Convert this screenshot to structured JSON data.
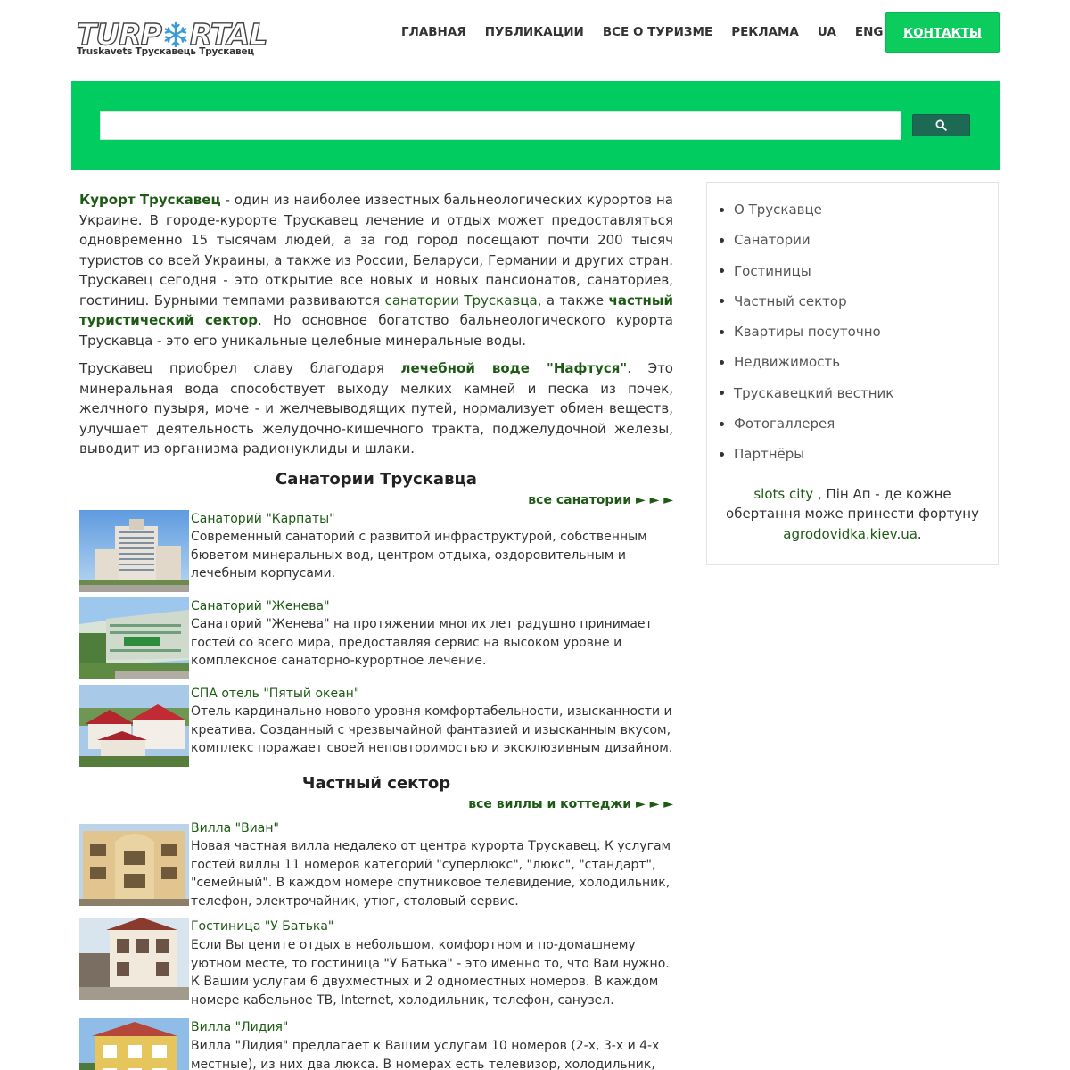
{
  "header": {
    "logo_text_left": "TURP",
    "logo_text_right": "RTAL",
    "logo_subtitle": "Truskavets Трускавець Трускавец",
    "nav": [
      "ГЛАВНАЯ",
      "ПУБЛИКАЦИИ",
      "ВСЕ О ТУРИЗМЕ",
      "РЕКЛАМА",
      "UA",
      "ENG"
    ],
    "contact_label": "КОНТАКТЫ"
  },
  "search": {
    "value": "",
    "button_icon": "search-icon"
  },
  "intro": {
    "p1_link1": "Курорт Трускавец",
    "p1_text1": " - один из наиболее известных бальнеологических курортов на Украине. В городе-курорте Трускавец лечение и отдых может предоставляться одновременно 15 тысячам людей, а за год город посещают почти 200 тысяч туристов со всей Украины, а также из России, Беларуси, Германии и других стран. Трускавец сегодня - это открытие все новых и новых пансионатов, санаториев, гостиниц. Бурными темпами развиваются ",
    "p1_link2": "санатории Трускавца",
    "p1_text2": ", а также ",
    "p1_link3": "частный туристический сектор",
    "p1_text3": ". Но основное богатство бальнеологического курорта Трускавца - это его уникальные целебные минеральные воды.",
    "p2_text1": "Трускавец приобрел славу благодаря ",
    "p2_link1": "лечебной воде \"Нафтуся\"",
    "p2_text2": ". Это минеральная вода способствует выходу мелких камней и песка из почек, желчного пузыря, моче - и желчевыводящих путей, нормализует обмен веществ, улучшает деятельность желудочно-кишечного тракта, поджелудочной железы, выводит из организма радионуклиды и шлаки."
  },
  "sanatoria": {
    "title": "Санатории Трускавца",
    "more": "все санатории ► ► ►",
    "items": [
      {
        "name": "Санаторий \"Карпаты\"",
        "desc": "Современный санаторий с развитой инфраструктурой, собственным бюветом минеральных вод, центром отдыха, оздоровительным и лечебным корпусами."
      },
      {
        "name": "Санаторий \"Женева\"",
        "desc": "Санаторий \"Женева\" на протяжении многих лет радушно принимает гостей со всего мира, предоставляя сервис на высоком уровне и комплексное санаторно-курортное лечение."
      },
      {
        "name": "СПА отель \"Пятый океан\"",
        "desc": "Отель кардинально нового уровня комфортабельности, изысканности и креатива. Созданный с чрезвычайной фантазией и изысканным вкусом, комплекс поражает своей неповторимостью и эксклюзивным дизайном."
      }
    ]
  },
  "private": {
    "title": "Частный сектор",
    "more": "все виллы и коттеджи ► ► ►",
    "items": [
      {
        "name": "Вилла \"Виан\"",
        "desc": "Новая частная вилла недалеко от центра курорта Трускавец. К услугам гостей виллы 11 номеров категорий \"суперлюкс\", \"люкс\", \"стандарт\", \"семейный\". В каждом номере спутниковое телевидение, холодильник, телефон, электрочайник, утюг, столовый сервис."
      },
      {
        "name": "Гостиница \"У Батька\"",
        "desc": "Если Вы цените отдых в небольшом, комфортном и по-домашнему уютном месте, то гостиница \"У Батька\" - это именно то, что Вам нужно. К Вашим услугам 6 двухместных и 2 одноместных номеров. В каждом номере кабельное TB, Internet, холодильник, телефон, санузел."
      },
      {
        "name": "Вилла \"Лидия\"",
        "desc": "Вилла \"Лидия\" предлагает к Вашим услугам 10 номеров (2-х, 3-х и 4-х местные), из них два люкса. В номерах есть телевизор, холодильник, утюг, санузел. Вода круглосуточно, отопление автономное."
      }
    ]
  },
  "sidebar": {
    "items": [
      "О Трускавце",
      "Санатории",
      "Гостиницы",
      "Частный сектор",
      "Квартиры посуточно",
      "Недвижимость",
      "Трускавецкий вестник",
      "Фотогаллерея",
      "Партнёры"
    ],
    "promo_link1": "slots city",
    "promo_text": " , Пін Ап - де кожне обертання може принести фортуну",
    "promo_link2": "agrodovidka.kiev.ua",
    "promo_end": "."
  },
  "colors": {
    "brand_green": "#00cc5f",
    "link_green": "#1d5b14",
    "search_button": "#1d6a54"
  }
}
